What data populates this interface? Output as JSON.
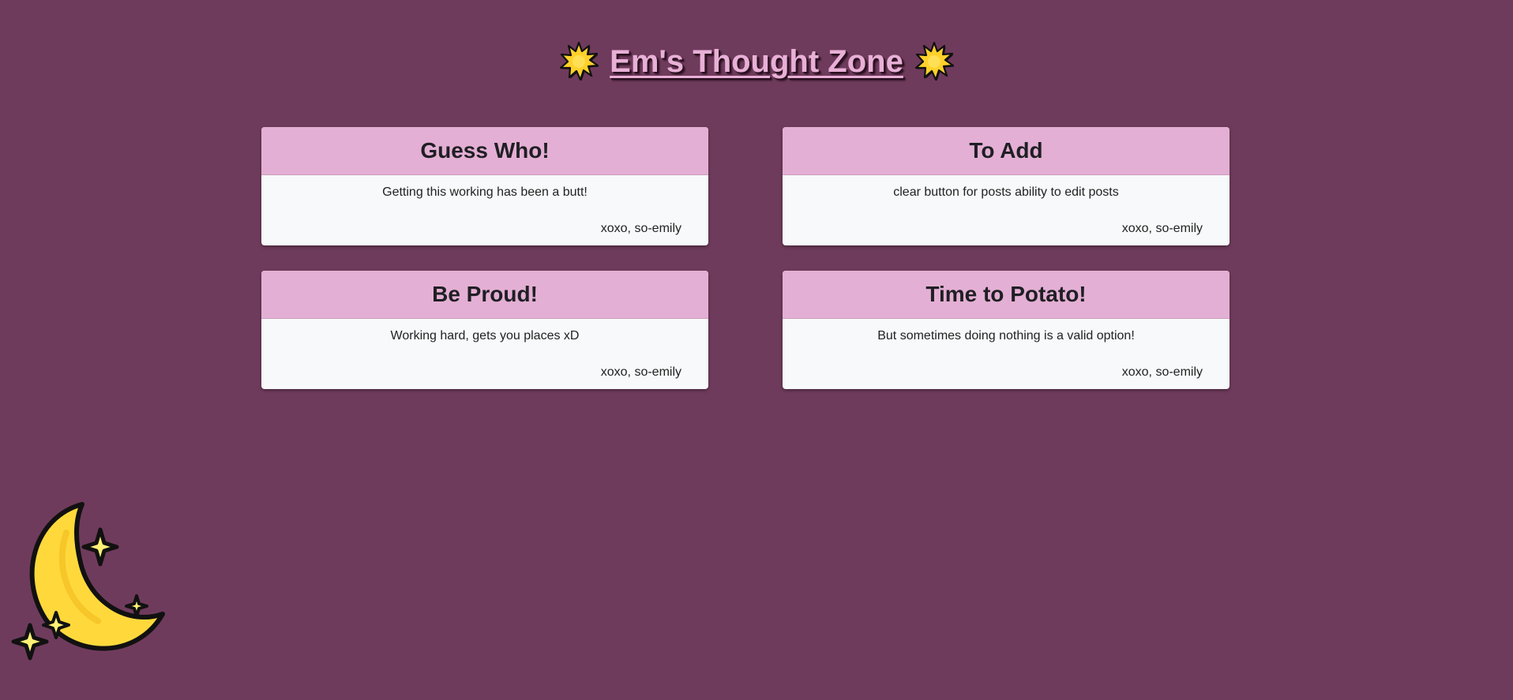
{
  "header": {
    "title": "Em's Thought Zone",
    "left_icon": "sun-icon",
    "right_icon": "sun-icon"
  },
  "posts": [
    {
      "title": "Guess Who!",
      "body": "Getting this working has been a butt!",
      "signature": "xoxo, so-emily"
    },
    {
      "title": "To Add",
      "body": "clear button for posts ability to edit posts",
      "signature": "xoxo, so-emily"
    },
    {
      "title": "Be Proud!",
      "body": "Working hard, gets you places xD",
      "signature": "xoxo, so-emily"
    },
    {
      "title": "Time to Potato!",
      "body": "But sometimes doing nothing is a valid option!",
      "signature": "xoxo, so-emily"
    }
  ],
  "decoration": {
    "icon": "moon-stars-icon"
  },
  "colors": {
    "background": "#6f3b5c",
    "card_header": "#e4afd4",
    "card_body": "#f7f9fa",
    "title_text": "#e8b0d6",
    "moon": "#ffd93b"
  }
}
